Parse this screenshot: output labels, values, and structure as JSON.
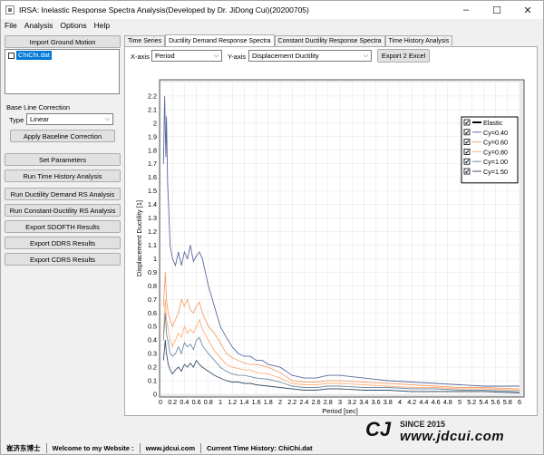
{
  "window": {
    "title": "IRSA: Inelastic Response Spectra Analysis(Developed by Dr. JiDong Cui)(20200705)",
    "controls": [
      "–",
      "☐",
      "✕"
    ]
  },
  "menu": [
    "File",
    "Analysis",
    "Options",
    "Help"
  ],
  "left_panel": {
    "import_button": "Import Ground Motion",
    "files": [
      {
        "name": "ChiChi.dat",
        "checked": false,
        "selected": true
      }
    ],
    "baseline_group": "Base Line Correction",
    "type_label": "Type",
    "type_value": "Linear",
    "apply_button": "Apply Baseline Correction",
    "set_params_button": "Set Parameters",
    "run_th_button": "Run Time History Analysis",
    "run_ddrs_button": "Run Ductility Demand RS Analysis",
    "run_cdrs_button": "Run Constant-Ductility RS Analysis",
    "export_sdofth_button": "Export SDOFTH Results",
    "export_ddrs_button": "Export DDRS Results",
    "export_cdrs_button": "Export CDRS Results"
  },
  "tabs": [
    "Time Series",
    "Ductility Demand Response Spectra",
    "Constant Ductility Response Spectra",
    "Time History Analysis"
  ],
  "active_tab": 1,
  "controls": {
    "xaxis_label": "X-axis",
    "xaxis_value": "Period",
    "yaxis_label": "Y-axis",
    "yaxis_value": "Displacement Ductility",
    "export_button": "Export 2 Excel"
  },
  "chart_data": {
    "type": "line",
    "xlabel": "Period [sec]",
    "ylabel": "Displacement Ductility [1]",
    "xlim": [
      0,
      6
    ],
    "ylim": [
      0,
      2.3
    ],
    "xticks": [
      "0",
      "0.2",
      "0.4",
      "0.6",
      "0.8",
      "1",
      "1.2",
      "1.4",
      "1.6",
      "1.8",
      "2",
      "2.2",
      "2.4",
      "2.6",
      "2.8",
      "3",
      "3.2",
      "3.4",
      "3.6",
      "3.8",
      "4",
      "4.2",
      "4.4",
      "4.6",
      "4.8",
      "5",
      "5.2",
      "5.4",
      "5.6",
      "5.8",
      "6"
    ],
    "yticks": [
      "0",
      "0.1",
      "0.2",
      "0.3",
      "0.4",
      "0.5",
      "0.6",
      "0.7",
      "0.8",
      "0.9",
      "1",
      "1.1",
      "1.2",
      "1.3",
      "1.4",
      "1.5",
      "1.6",
      "1.7",
      "1.8",
      "1.9",
      "2",
      "2.1",
      "2.2"
    ],
    "grid": true,
    "legend_position": "top-right",
    "series": [
      {
        "name": "Elastic",
        "color": "#000000",
        "visible": false,
        "x": [],
        "y": []
      },
      {
        "name": "Cy=0.40",
        "color": "#5a6a9c",
        "x": [
          0.05,
          0.07,
          0.09,
          0.1,
          0.12,
          0.14,
          0.16,
          0.2,
          0.25,
          0.3,
          0.35,
          0.4,
          0.45,
          0.5,
          0.55,
          0.6,
          0.65,
          0.7,
          0.8,
          0.9,
          1.0,
          1.1,
          1.2,
          1.3,
          1.4,
          1.5,
          1.6,
          1.7,
          1.8,
          2.0,
          2.2,
          2.4,
          2.6,
          2.8,
          3.0,
          3.4,
          3.8,
          4.2,
          4.6,
          5.0,
          5.4,
          5.8,
          6.0
        ],
        "y": [
          1.7,
          2.2,
          1.75,
          2.05,
          1.55,
          1.35,
          1.1,
          1.0,
          0.95,
          1.05,
          0.95,
          1.05,
          1.0,
          1.1,
          0.98,
          1.02,
          1.05,
          1.0,
          0.8,
          0.65,
          0.5,
          0.42,
          0.35,
          0.3,
          0.28,
          0.28,
          0.25,
          0.25,
          0.22,
          0.2,
          0.14,
          0.12,
          0.12,
          0.14,
          0.14,
          0.12,
          0.1,
          0.09,
          0.08,
          0.07,
          0.06,
          0.06,
          0.06
        ]
      },
      {
        "name": "Cy=0.60",
        "color": "#f4a170",
        "x": [
          0.05,
          0.08,
          0.1,
          0.13,
          0.16,
          0.2,
          0.25,
          0.3,
          0.35,
          0.4,
          0.45,
          0.5,
          0.55,
          0.6,
          0.65,
          0.7,
          0.8,
          0.9,
          1.0,
          1.1,
          1.2,
          1.3,
          1.4,
          1.5,
          1.6,
          1.8,
          2.0,
          2.2,
          2.4,
          2.6,
          2.8,
          3.0,
          3.4,
          3.8,
          4.2,
          4.6,
          5.0,
          5.4,
          6.0
        ],
        "y": [
          0.65,
          0.9,
          0.7,
          0.6,
          0.55,
          0.5,
          0.55,
          0.6,
          0.7,
          0.65,
          0.7,
          0.62,
          0.6,
          0.65,
          0.68,
          0.6,
          0.5,
          0.45,
          0.38,
          0.3,
          0.27,
          0.25,
          0.23,
          0.22,
          0.22,
          0.2,
          0.16,
          0.1,
          0.09,
          0.09,
          0.1,
          0.1,
          0.09,
          0.08,
          0.07,
          0.06,
          0.05,
          0.05,
          0.04
        ]
      },
      {
        "name": "Cy=0.80",
        "color": "#ffb07a",
        "x": [
          0.05,
          0.08,
          0.1,
          0.13,
          0.16,
          0.2,
          0.25,
          0.3,
          0.35,
          0.4,
          0.45,
          0.5,
          0.55,
          0.6,
          0.65,
          0.7,
          0.8,
          0.9,
          1.0,
          1.1,
          1.2,
          1.3,
          1.4,
          1.5,
          1.6,
          1.8,
          2.0,
          2.2,
          2.4,
          2.6,
          2.8,
          3.0,
          3.4,
          3.8,
          4.2,
          4.6,
          5.0,
          5.4,
          6.0
        ],
        "y": [
          0.45,
          0.7,
          0.55,
          0.48,
          0.4,
          0.35,
          0.4,
          0.45,
          0.42,
          0.5,
          0.45,
          0.48,
          0.45,
          0.5,
          0.55,
          0.48,
          0.4,
          0.32,
          0.27,
          0.22,
          0.2,
          0.19,
          0.18,
          0.18,
          0.16,
          0.15,
          0.12,
          0.08,
          0.07,
          0.07,
          0.08,
          0.08,
          0.07,
          0.06,
          0.05,
          0.05,
          0.04,
          0.04,
          0.03
        ]
      },
      {
        "name": "Cy=1.00",
        "color": "#6d8fa8",
        "x": [
          0.05,
          0.08,
          0.1,
          0.13,
          0.16,
          0.2,
          0.25,
          0.3,
          0.35,
          0.4,
          0.45,
          0.5,
          0.55,
          0.6,
          0.65,
          0.7,
          0.8,
          0.9,
          1.0,
          1.1,
          1.2,
          1.3,
          1.4,
          1.5,
          1.6,
          1.8,
          2.0,
          2.2,
          2.4,
          2.6,
          2.8,
          3.0,
          3.4,
          3.8,
          4.2,
          4.6,
          5.0,
          5.4,
          6.0
        ],
        "y": [
          0.4,
          0.6,
          0.45,
          0.38,
          0.3,
          0.28,
          0.3,
          0.35,
          0.3,
          0.38,
          0.35,
          0.37,
          0.33,
          0.4,
          0.42,
          0.36,
          0.3,
          0.25,
          0.2,
          0.17,
          0.15,
          0.14,
          0.14,
          0.13,
          0.12,
          0.11,
          0.09,
          0.06,
          0.05,
          0.05,
          0.06,
          0.06,
          0.05,
          0.05,
          0.04,
          0.04,
          0.03,
          0.03,
          0.02
        ]
      },
      {
        "name": "Cy=1.50",
        "color": "#3a4f6b",
        "x": [
          0.05,
          0.08,
          0.1,
          0.13,
          0.16,
          0.2,
          0.25,
          0.3,
          0.35,
          0.4,
          0.45,
          0.5,
          0.55,
          0.6,
          0.65,
          0.7,
          0.8,
          0.9,
          1.0,
          1.1,
          1.2,
          1.3,
          1.4,
          1.5,
          1.6,
          1.8,
          2.0,
          2.2,
          2.4,
          2.6,
          2.8,
          3.0,
          3.4,
          3.8,
          4.2,
          4.6,
          5.0,
          5.4,
          6.0
        ],
        "y": [
          0.25,
          0.4,
          0.3,
          0.22,
          0.18,
          0.15,
          0.18,
          0.2,
          0.17,
          0.22,
          0.2,
          0.23,
          0.2,
          0.25,
          0.22,
          0.2,
          0.17,
          0.14,
          0.12,
          0.1,
          0.09,
          0.09,
          0.08,
          0.08,
          0.07,
          0.06,
          0.05,
          0.04,
          0.03,
          0.03,
          0.04,
          0.04,
          0.03,
          0.03,
          0.02,
          0.02,
          0.02,
          0.02,
          0.01
        ]
      }
    ]
  },
  "statusbar": {
    "owner": "崔济东博士",
    "welcome": "Welcome to my Website :",
    "site": "www.jdcui.com",
    "current_file": "Current Time History: ChiChi.dat"
  },
  "watermark": {
    "logo": "CJ",
    "since": "SINCE 2015",
    "url": "www.jdcui.com"
  }
}
